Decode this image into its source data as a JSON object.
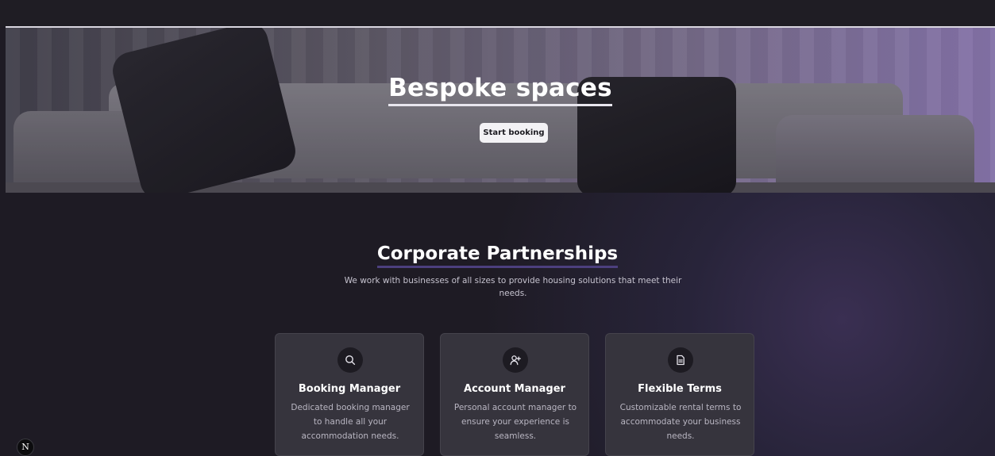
{
  "hero": {
    "title": "Bespoke spaces",
    "button_label": "Start booking"
  },
  "section": {
    "title": "Corporate Partnerships",
    "subtitle": "We work with businesses of all sizes to provide housing solutions that meet their needs."
  },
  "cards": [
    {
      "icon": "search-icon",
      "title": "Booking Manager",
      "description": "Dedicated booking manager to handle all your accommodation needs."
    },
    {
      "icon": "user-plus-icon",
      "title": "Account Manager",
      "description": "Personal account manager to ensure your experience is seamless."
    },
    {
      "icon": "document-icon",
      "title": "Flexible Terms",
      "description": "Customizable rental terms to accommodate your business needs."
    }
  ],
  "badge": {
    "label": "N"
  },
  "colors": {
    "background": "#1e1b24",
    "card": "#36343d",
    "accent_underline": "#4c3f7e",
    "button": "#f3f2f5"
  }
}
